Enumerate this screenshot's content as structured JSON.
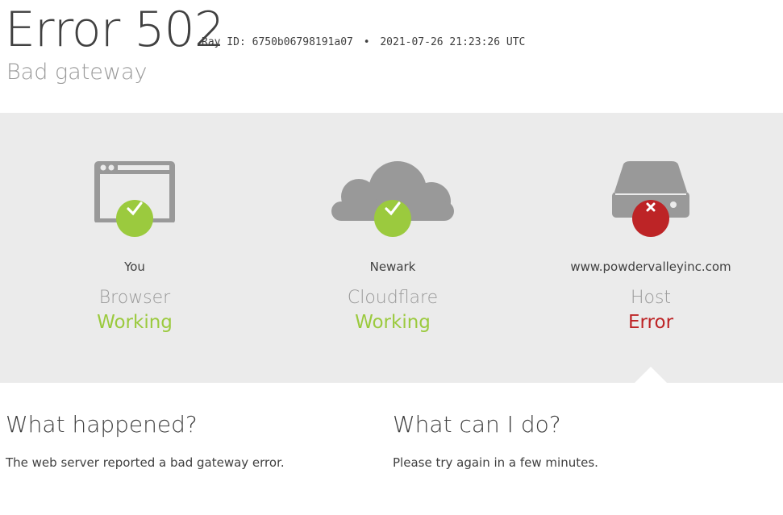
{
  "header": {
    "error_code": "Error 502",
    "ray_id_label": "Ray ID:",
    "ray_id": "6750b06798191a07",
    "separator": "•",
    "timestamp": "2021-07-26 21:23:26 UTC",
    "subtitle": "Bad gateway"
  },
  "status": [
    {
      "location": "You",
      "role": "Browser",
      "state": "Working",
      "result": "ok",
      "icon": "browser-icon"
    },
    {
      "location": "Newark",
      "role": "Cloudflare",
      "state": "Working",
      "result": "ok",
      "icon": "cloud-icon"
    },
    {
      "location": "www.powdervalleyinc.com",
      "role": "Host",
      "state": "Error",
      "result": "error",
      "icon": "server-icon"
    }
  ],
  "colors": {
    "ok": "#9bca3e",
    "error": "#bd2426",
    "icon_gray": "#999999",
    "band": "#ebebeb"
  },
  "what_happened": {
    "title": "What happened?",
    "text": "The web server reported a bad gateway error."
  },
  "what_can_i_do": {
    "title": "What can I do?",
    "text": "Please try again in a few minutes."
  }
}
